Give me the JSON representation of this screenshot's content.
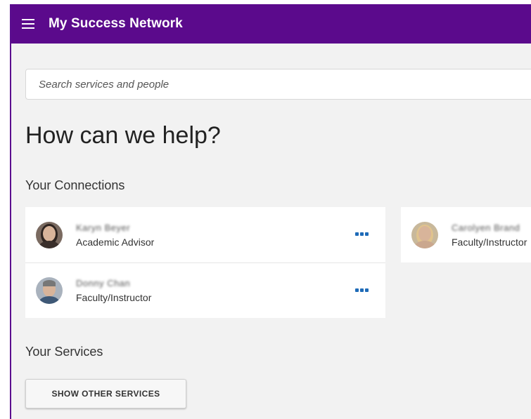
{
  "app": {
    "title": "My Success Network",
    "menu_icon": "hamburger-menu-icon"
  },
  "search": {
    "placeholder": "Search services and people",
    "value": ""
  },
  "heading": "How can we help?",
  "connections": {
    "title": "Your Connections",
    "items": [
      {
        "name": "Karyn Beyer",
        "role": "Academic Advisor",
        "more_icon": "more-options-icon"
      },
      {
        "name": "Donny Chan",
        "role": "Faculty/Instructor",
        "more_icon": "more-options-icon"
      },
      {
        "name": "Carolyen Brand",
        "role": "Faculty/Instructor"
      }
    ]
  },
  "services": {
    "title": "Your Services",
    "button_label": "SHOW OTHER SERVICES"
  },
  "colors": {
    "brand": "#5b0a8c",
    "accent": "#1e6bb8",
    "background": "#f2f2f2"
  }
}
